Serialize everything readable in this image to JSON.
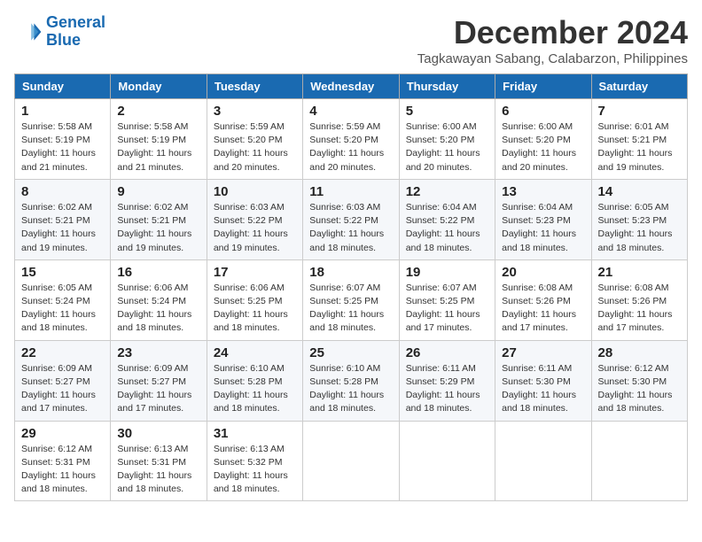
{
  "logo": {
    "line1": "General",
    "line2": "Blue"
  },
  "title": "December 2024",
  "location": "Tagkawayan Sabang, Calabarzon, Philippines",
  "headers": [
    "Sunday",
    "Monday",
    "Tuesday",
    "Wednesday",
    "Thursday",
    "Friday",
    "Saturday"
  ],
  "weeks": [
    [
      {
        "day": "1",
        "info": "Sunrise: 5:58 AM\nSunset: 5:19 PM\nDaylight: 11 hours\nand 21 minutes."
      },
      {
        "day": "2",
        "info": "Sunrise: 5:58 AM\nSunset: 5:19 PM\nDaylight: 11 hours\nand 21 minutes."
      },
      {
        "day": "3",
        "info": "Sunrise: 5:59 AM\nSunset: 5:20 PM\nDaylight: 11 hours\nand 20 minutes."
      },
      {
        "day": "4",
        "info": "Sunrise: 5:59 AM\nSunset: 5:20 PM\nDaylight: 11 hours\nand 20 minutes."
      },
      {
        "day": "5",
        "info": "Sunrise: 6:00 AM\nSunset: 5:20 PM\nDaylight: 11 hours\nand 20 minutes."
      },
      {
        "day": "6",
        "info": "Sunrise: 6:00 AM\nSunset: 5:20 PM\nDaylight: 11 hours\nand 20 minutes."
      },
      {
        "day": "7",
        "info": "Sunrise: 6:01 AM\nSunset: 5:21 PM\nDaylight: 11 hours\nand 19 minutes."
      }
    ],
    [
      {
        "day": "8",
        "info": "Sunrise: 6:02 AM\nSunset: 5:21 PM\nDaylight: 11 hours\nand 19 minutes."
      },
      {
        "day": "9",
        "info": "Sunrise: 6:02 AM\nSunset: 5:21 PM\nDaylight: 11 hours\nand 19 minutes."
      },
      {
        "day": "10",
        "info": "Sunrise: 6:03 AM\nSunset: 5:22 PM\nDaylight: 11 hours\nand 19 minutes."
      },
      {
        "day": "11",
        "info": "Sunrise: 6:03 AM\nSunset: 5:22 PM\nDaylight: 11 hours\nand 18 minutes."
      },
      {
        "day": "12",
        "info": "Sunrise: 6:04 AM\nSunset: 5:22 PM\nDaylight: 11 hours\nand 18 minutes."
      },
      {
        "day": "13",
        "info": "Sunrise: 6:04 AM\nSunset: 5:23 PM\nDaylight: 11 hours\nand 18 minutes."
      },
      {
        "day": "14",
        "info": "Sunrise: 6:05 AM\nSunset: 5:23 PM\nDaylight: 11 hours\nand 18 minutes."
      }
    ],
    [
      {
        "day": "15",
        "info": "Sunrise: 6:05 AM\nSunset: 5:24 PM\nDaylight: 11 hours\nand 18 minutes."
      },
      {
        "day": "16",
        "info": "Sunrise: 6:06 AM\nSunset: 5:24 PM\nDaylight: 11 hours\nand 18 minutes."
      },
      {
        "day": "17",
        "info": "Sunrise: 6:06 AM\nSunset: 5:25 PM\nDaylight: 11 hours\nand 18 minutes."
      },
      {
        "day": "18",
        "info": "Sunrise: 6:07 AM\nSunset: 5:25 PM\nDaylight: 11 hours\nand 18 minutes."
      },
      {
        "day": "19",
        "info": "Sunrise: 6:07 AM\nSunset: 5:25 PM\nDaylight: 11 hours\nand 17 minutes."
      },
      {
        "day": "20",
        "info": "Sunrise: 6:08 AM\nSunset: 5:26 PM\nDaylight: 11 hours\nand 17 minutes."
      },
      {
        "day": "21",
        "info": "Sunrise: 6:08 AM\nSunset: 5:26 PM\nDaylight: 11 hours\nand 17 minutes."
      }
    ],
    [
      {
        "day": "22",
        "info": "Sunrise: 6:09 AM\nSunset: 5:27 PM\nDaylight: 11 hours\nand 17 minutes."
      },
      {
        "day": "23",
        "info": "Sunrise: 6:09 AM\nSunset: 5:27 PM\nDaylight: 11 hours\nand 17 minutes."
      },
      {
        "day": "24",
        "info": "Sunrise: 6:10 AM\nSunset: 5:28 PM\nDaylight: 11 hours\nand 18 minutes."
      },
      {
        "day": "25",
        "info": "Sunrise: 6:10 AM\nSunset: 5:28 PM\nDaylight: 11 hours\nand 18 minutes."
      },
      {
        "day": "26",
        "info": "Sunrise: 6:11 AM\nSunset: 5:29 PM\nDaylight: 11 hours\nand 18 minutes."
      },
      {
        "day": "27",
        "info": "Sunrise: 6:11 AM\nSunset: 5:30 PM\nDaylight: 11 hours\nand 18 minutes."
      },
      {
        "day": "28",
        "info": "Sunrise: 6:12 AM\nSunset: 5:30 PM\nDaylight: 11 hours\nand 18 minutes."
      }
    ],
    [
      {
        "day": "29",
        "info": "Sunrise: 6:12 AM\nSunset: 5:31 PM\nDaylight: 11 hours\nand 18 minutes."
      },
      {
        "day": "30",
        "info": "Sunrise: 6:13 AM\nSunset: 5:31 PM\nDaylight: 11 hours\nand 18 minutes."
      },
      {
        "day": "31",
        "info": "Sunrise: 6:13 AM\nSunset: 5:32 PM\nDaylight: 11 hours\nand 18 minutes."
      },
      {
        "day": "",
        "info": ""
      },
      {
        "day": "",
        "info": ""
      },
      {
        "day": "",
        "info": ""
      },
      {
        "day": "",
        "info": ""
      }
    ]
  ]
}
